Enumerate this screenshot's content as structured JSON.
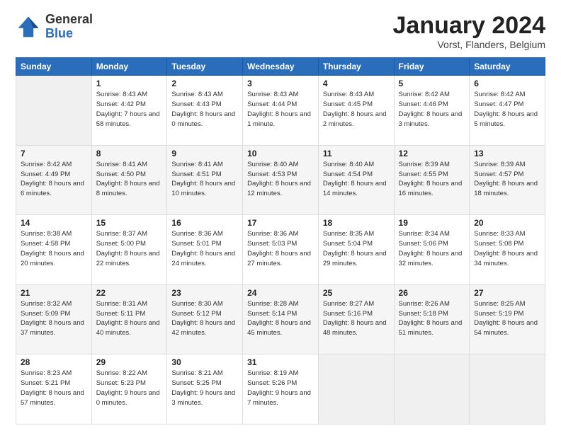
{
  "logo": {
    "general": "General",
    "blue": "Blue"
  },
  "header": {
    "title": "January 2024",
    "subtitle": "Vorst, Flanders, Belgium"
  },
  "weekdays": [
    "Sunday",
    "Monday",
    "Tuesday",
    "Wednesday",
    "Thursday",
    "Friday",
    "Saturday"
  ],
  "weeks": [
    [
      {
        "day": "",
        "sunrise": "",
        "sunset": "",
        "daylight": "",
        "empty": true
      },
      {
        "day": "1",
        "sunrise": "Sunrise: 8:43 AM",
        "sunset": "Sunset: 4:42 PM",
        "daylight": "Daylight: 7 hours and 58 minutes."
      },
      {
        "day": "2",
        "sunrise": "Sunrise: 8:43 AM",
        "sunset": "Sunset: 4:43 PM",
        "daylight": "Daylight: 8 hours and 0 minutes."
      },
      {
        "day": "3",
        "sunrise": "Sunrise: 8:43 AM",
        "sunset": "Sunset: 4:44 PM",
        "daylight": "Daylight: 8 hours and 1 minute."
      },
      {
        "day": "4",
        "sunrise": "Sunrise: 8:43 AM",
        "sunset": "Sunset: 4:45 PM",
        "daylight": "Daylight: 8 hours and 2 minutes."
      },
      {
        "day": "5",
        "sunrise": "Sunrise: 8:42 AM",
        "sunset": "Sunset: 4:46 PM",
        "daylight": "Daylight: 8 hours and 3 minutes."
      },
      {
        "day": "6",
        "sunrise": "Sunrise: 8:42 AM",
        "sunset": "Sunset: 4:47 PM",
        "daylight": "Daylight: 8 hours and 5 minutes."
      }
    ],
    [
      {
        "day": "7",
        "sunrise": "Sunrise: 8:42 AM",
        "sunset": "Sunset: 4:49 PM",
        "daylight": "Daylight: 8 hours and 6 minutes."
      },
      {
        "day": "8",
        "sunrise": "Sunrise: 8:41 AM",
        "sunset": "Sunset: 4:50 PM",
        "daylight": "Daylight: 8 hours and 8 minutes."
      },
      {
        "day": "9",
        "sunrise": "Sunrise: 8:41 AM",
        "sunset": "Sunset: 4:51 PM",
        "daylight": "Daylight: 8 hours and 10 minutes."
      },
      {
        "day": "10",
        "sunrise": "Sunrise: 8:40 AM",
        "sunset": "Sunset: 4:53 PM",
        "daylight": "Daylight: 8 hours and 12 minutes."
      },
      {
        "day": "11",
        "sunrise": "Sunrise: 8:40 AM",
        "sunset": "Sunset: 4:54 PM",
        "daylight": "Daylight: 8 hours and 14 minutes."
      },
      {
        "day": "12",
        "sunrise": "Sunrise: 8:39 AM",
        "sunset": "Sunset: 4:55 PM",
        "daylight": "Daylight: 8 hours and 16 minutes."
      },
      {
        "day": "13",
        "sunrise": "Sunrise: 8:39 AM",
        "sunset": "Sunset: 4:57 PM",
        "daylight": "Daylight: 8 hours and 18 minutes."
      }
    ],
    [
      {
        "day": "14",
        "sunrise": "Sunrise: 8:38 AM",
        "sunset": "Sunset: 4:58 PM",
        "daylight": "Daylight: 8 hours and 20 minutes."
      },
      {
        "day": "15",
        "sunrise": "Sunrise: 8:37 AM",
        "sunset": "Sunset: 5:00 PM",
        "daylight": "Daylight: 8 hours and 22 minutes."
      },
      {
        "day": "16",
        "sunrise": "Sunrise: 8:36 AM",
        "sunset": "Sunset: 5:01 PM",
        "daylight": "Daylight: 8 hours and 24 minutes."
      },
      {
        "day": "17",
        "sunrise": "Sunrise: 8:36 AM",
        "sunset": "Sunset: 5:03 PM",
        "daylight": "Daylight: 8 hours and 27 minutes."
      },
      {
        "day": "18",
        "sunrise": "Sunrise: 8:35 AM",
        "sunset": "Sunset: 5:04 PM",
        "daylight": "Daylight: 8 hours and 29 minutes."
      },
      {
        "day": "19",
        "sunrise": "Sunrise: 8:34 AM",
        "sunset": "Sunset: 5:06 PM",
        "daylight": "Daylight: 8 hours and 32 minutes."
      },
      {
        "day": "20",
        "sunrise": "Sunrise: 8:33 AM",
        "sunset": "Sunset: 5:08 PM",
        "daylight": "Daylight: 8 hours and 34 minutes."
      }
    ],
    [
      {
        "day": "21",
        "sunrise": "Sunrise: 8:32 AM",
        "sunset": "Sunset: 5:09 PM",
        "daylight": "Daylight: 8 hours and 37 minutes."
      },
      {
        "day": "22",
        "sunrise": "Sunrise: 8:31 AM",
        "sunset": "Sunset: 5:11 PM",
        "daylight": "Daylight: 8 hours and 40 minutes."
      },
      {
        "day": "23",
        "sunrise": "Sunrise: 8:30 AM",
        "sunset": "Sunset: 5:12 PM",
        "daylight": "Daylight: 8 hours and 42 minutes."
      },
      {
        "day": "24",
        "sunrise": "Sunrise: 8:28 AM",
        "sunset": "Sunset: 5:14 PM",
        "daylight": "Daylight: 8 hours and 45 minutes."
      },
      {
        "day": "25",
        "sunrise": "Sunrise: 8:27 AM",
        "sunset": "Sunset: 5:16 PM",
        "daylight": "Daylight: 8 hours and 48 minutes."
      },
      {
        "day": "26",
        "sunrise": "Sunrise: 8:26 AM",
        "sunset": "Sunset: 5:18 PM",
        "daylight": "Daylight: 8 hours and 51 minutes."
      },
      {
        "day": "27",
        "sunrise": "Sunrise: 8:25 AM",
        "sunset": "Sunset: 5:19 PM",
        "daylight": "Daylight: 8 hours and 54 minutes."
      }
    ],
    [
      {
        "day": "28",
        "sunrise": "Sunrise: 8:23 AM",
        "sunset": "Sunset: 5:21 PM",
        "daylight": "Daylight: 8 hours and 57 minutes."
      },
      {
        "day": "29",
        "sunrise": "Sunrise: 8:22 AM",
        "sunset": "Sunset: 5:23 PM",
        "daylight": "Daylight: 9 hours and 0 minutes."
      },
      {
        "day": "30",
        "sunrise": "Sunrise: 8:21 AM",
        "sunset": "Sunset: 5:25 PM",
        "daylight": "Daylight: 9 hours and 3 minutes."
      },
      {
        "day": "31",
        "sunrise": "Sunrise: 8:19 AM",
        "sunset": "Sunset: 5:26 PM",
        "daylight": "Daylight: 9 hours and 7 minutes."
      },
      {
        "day": "",
        "sunrise": "",
        "sunset": "",
        "daylight": "",
        "empty": true
      },
      {
        "day": "",
        "sunrise": "",
        "sunset": "",
        "daylight": "",
        "empty": true
      },
      {
        "day": "",
        "sunrise": "",
        "sunset": "",
        "daylight": "",
        "empty": true
      }
    ]
  ]
}
